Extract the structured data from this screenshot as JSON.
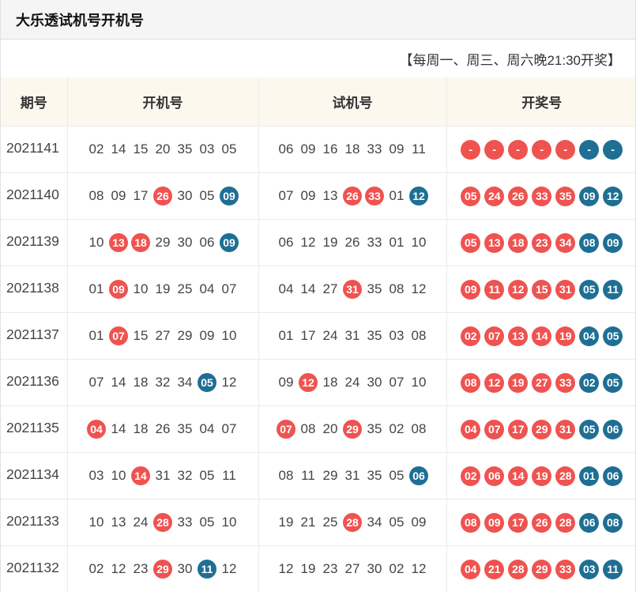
{
  "title": "大乐透试机号开机号",
  "schedule": "【每周一、周三、周六晚21:30开奖】",
  "colors": {
    "red_ball": "#ef5350",
    "blue_ball": "#1f6f94",
    "header_bg": "#fdf8ee"
  },
  "columns": [
    "期号",
    "开机号",
    "试机号",
    "开奖号"
  ],
  "rows": [
    {
      "issue": "2021141",
      "open": [
        [
          "02",
          ""
        ],
        [
          "14",
          ""
        ],
        [
          "15",
          ""
        ],
        [
          "20",
          ""
        ],
        [
          "35",
          ""
        ],
        [
          "03",
          ""
        ],
        [
          "05",
          ""
        ]
      ],
      "trial": [
        [
          "06",
          ""
        ],
        [
          "09",
          ""
        ],
        [
          "16",
          ""
        ],
        [
          "18",
          ""
        ],
        [
          "33",
          ""
        ],
        [
          "09",
          ""
        ],
        [
          "11",
          ""
        ]
      ],
      "prize": [
        [
          "-",
          "red"
        ],
        [
          "-",
          "red"
        ],
        [
          "-",
          "red"
        ],
        [
          "-",
          "red"
        ],
        [
          "-",
          "red"
        ],
        [
          "-",
          "blue"
        ],
        [
          "-",
          "blue"
        ]
      ]
    },
    {
      "issue": "2021140",
      "open": [
        [
          "08",
          ""
        ],
        [
          "09",
          ""
        ],
        [
          "17",
          ""
        ],
        [
          "26",
          "red"
        ],
        [
          "30",
          ""
        ],
        [
          "05",
          ""
        ],
        [
          "09",
          "blue"
        ]
      ],
      "trial": [
        [
          "07",
          ""
        ],
        [
          "09",
          ""
        ],
        [
          "13",
          ""
        ],
        [
          "26",
          "red"
        ],
        [
          "33",
          "red"
        ],
        [
          "01",
          ""
        ],
        [
          "12",
          "blue"
        ]
      ],
      "prize": [
        [
          "05",
          "red"
        ],
        [
          "24",
          "red"
        ],
        [
          "26",
          "red"
        ],
        [
          "33",
          "red"
        ],
        [
          "35",
          "red"
        ],
        [
          "09",
          "blue"
        ],
        [
          "12",
          "blue"
        ]
      ]
    },
    {
      "issue": "2021139",
      "open": [
        [
          "10",
          ""
        ],
        [
          "13",
          "red"
        ],
        [
          "18",
          "red"
        ],
        [
          "29",
          ""
        ],
        [
          "30",
          ""
        ],
        [
          "06",
          ""
        ],
        [
          "09",
          "blue"
        ]
      ],
      "trial": [
        [
          "06",
          ""
        ],
        [
          "12",
          ""
        ],
        [
          "19",
          ""
        ],
        [
          "26",
          ""
        ],
        [
          "33",
          ""
        ],
        [
          "01",
          ""
        ],
        [
          "10",
          ""
        ]
      ],
      "prize": [
        [
          "05",
          "red"
        ],
        [
          "13",
          "red"
        ],
        [
          "18",
          "red"
        ],
        [
          "23",
          "red"
        ],
        [
          "34",
          "red"
        ],
        [
          "08",
          "blue"
        ],
        [
          "09",
          "blue"
        ]
      ]
    },
    {
      "issue": "2021138",
      "open": [
        [
          "01",
          ""
        ],
        [
          "09",
          "red"
        ],
        [
          "10",
          ""
        ],
        [
          "19",
          ""
        ],
        [
          "25",
          ""
        ],
        [
          "04",
          ""
        ],
        [
          "07",
          ""
        ]
      ],
      "trial": [
        [
          "04",
          ""
        ],
        [
          "14",
          ""
        ],
        [
          "27",
          ""
        ],
        [
          "31",
          "red"
        ],
        [
          "35",
          ""
        ],
        [
          "08",
          ""
        ],
        [
          "12",
          ""
        ]
      ],
      "prize": [
        [
          "09",
          "red"
        ],
        [
          "11",
          "red"
        ],
        [
          "12",
          "red"
        ],
        [
          "15",
          "red"
        ],
        [
          "31",
          "red"
        ],
        [
          "05",
          "blue"
        ],
        [
          "11",
          "blue"
        ]
      ]
    },
    {
      "issue": "2021137",
      "open": [
        [
          "01",
          ""
        ],
        [
          "07",
          "red"
        ],
        [
          "15",
          ""
        ],
        [
          "27",
          ""
        ],
        [
          "29",
          ""
        ],
        [
          "09",
          ""
        ],
        [
          "10",
          ""
        ]
      ],
      "trial": [
        [
          "01",
          ""
        ],
        [
          "17",
          ""
        ],
        [
          "24",
          ""
        ],
        [
          "31",
          ""
        ],
        [
          "35",
          ""
        ],
        [
          "03",
          ""
        ],
        [
          "08",
          ""
        ]
      ],
      "prize": [
        [
          "02",
          "red"
        ],
        [
          "07",
          "red"
        ],
        [
          "13",
          "red"
        ],
        [
          "14",
          "red"
        ],
        [
          "19",
          "red"
        ],
        [
          "04",
          "blue"
        ],
        [
          "05",
          "blue"
        ]
      ]
    },
    {
      "issue": "2021136",
      "open": [
        [
          "07",
          ""
        ],
        [
          "14",
          ""
        ],
        [
          "18",
          ""
        ],
        [
          "32",
          ""
        ],
        [
          "34",
          ""
        ],
        [
          "05",
          "blue"
        ],
        [
          "12",
          ""
        ]
      ],
      "trial": [
        [
          "09",
          ""
        ],
        [
          "12",
          "red"
        ],
        [
          "18",
          ""
        ],
        [
          "24",
          ""
        ],
        [
          "30",
          ""
        ],
        [
          "07",
          ""
        ],
        [
          "10",
          ""
        ]
      ],
      "prize": [
        [
          "08",
          "red"
        ],
        [
          "12",
          "red"
        ],
        [
          "19",
          "red"
        ],
        [
          "27",
          "red"
        ],
        [
          "33",
          "red"
        ],
        [
          "02",
          "blue"
        ],
        [
          "05",
          "blue"
        ]
      ]
    },
    {
      "issue": "2021135",
      "open": [
        [
          "04",
          "red"
        ],
        [
          "14",
          ""
        ],
        [
          "18",
          ""
        ],
        [
          "26",
          ""
        ],
        [
          "35",
          ""
        ],
        [
          "04",
          ""
        ],
        [
          "07",
          ""
        ]
      ],
      "trial": [
        [
          "07",
          "red"
        ],
        [
          "08",
          ""
        ],
        [
          "20",
          ""
        ],
        [
          "29",
          "red"
        ],
        [
          "35",
          ""
        ],
        [
          "02",
          ""
        ],
        [
          "08",
          ""
        ]
      ],
      "prize": [
        [
          "04",
          "red"
        ],
        [
          "07",
          "red"
        ],
        [
          "17",
          "red"
        ],
        [
          "29",
          "red"
        ],
        [
          "31",
          "red"
        ],
        [
          "05",
          "blue"
        ],
        [
          "06",
          "blue"
        ]
      ]
    },
    {
      "issue": "2021134",
      "open": [
        [
          "03",
          ""
        ],
        [
          "10",
          ""
        ],
        [
          "14",
          "red"
        ],
        [
          "31",
          ""
        ],
        [
          "32",
          ""
        ],
        [
          "05",
          ""
        ],
        [
          "11",
          ""
        ]
      ],
      "trial": [
        [
          "08",
          ""
        ],
        [
          "11",
          ""
        ],
        [
          "29",
          ""
        ],
        [
          "31",
          ""
        ],
        [
          "35",
          ""
        ],
        [
          "05",
          ""
        ],
        [
          "06",
          "blue"
        ]
      ],
      "prize": [
        [
          "02",
          "red"
        ],
        [
          "06",
          "red"
        ],
        [
          "14",
          "red"
        ],
        [
          "19",
          "red"
        ],
        [
          "28",
          "red"
        ],
        [
          "01",
          "blue"
        ],
        [
          "06",
          "blue"
        ]
      ]
    },
    {
      "issue": "2021133",
      "open": [
        [
          "10",
          ""
        ],
        [
          "13",
          ""
        ],
        [
          "24",
          ""
        ],
        [
          "28",
          "red"
        ],
        [
          "33",
          ""
        ],
        [
          "05",
          ""
        ],
        [
          "10",
          ""
        ]
      ],
      "trial": [
        [
          "19",
          ""
        ],
        [
          "21",
          ""
        ],
        [
          "25",
          ""
        ],
        [
          "28",
          "red"
        ],
        [
          "34",
          ""
        ],
        [
          "05",
          ""
        ],
        [
          "09",
          ""
        ]
      ],
      "prize": [
        [
          "08",
          "red"
        ],
        [
          "09",
          "red"
        ],
        [
          "17",
          "red"
        ],
        [
          "26",
          "red"
        ],
        [
          "28",
          "red"
        ],
        [
          "06",
          "blue"
        ],
        [
          "08",
          "blue"
        ]
      ]
    },
    {
      "issue": "2021132",
      "open": [
        [
          "02",
          ""
        ],
        [
          "12",
          ""
        ],
        [
          "23",
          ""
        ],
        [
          "29",
          "red"
        ],
        [
          "30",
          ""
        ],
        [
          "11",
          "blue"
        ],
        [
          "12",
          ""
        ]
      ],
      "trial": [
        [
          "12",
          ""
        ],
        [
          "19",
          ""
        ],
        [
          "23",
          ""
        ],
        [
          "27",
          ""
        ],
        [
          "30",
          ""
        ],
        [
          "02",
          ""
        ],
        [
          "12",
          ""
        ]
      ],
      "prize": [
        [
          "04",
          "red"
        ],
        [
          "21",
          "red"
        ],
        [
          "28",
          "red"
        ],
        [
          "29",
          "red"
        ],
        [
          "33",
          "red"
        ],
        [
          "03",
          "blue"
        ],
        [
          "11",
          "blue"
        ]
      ]
    }
  ]
}
